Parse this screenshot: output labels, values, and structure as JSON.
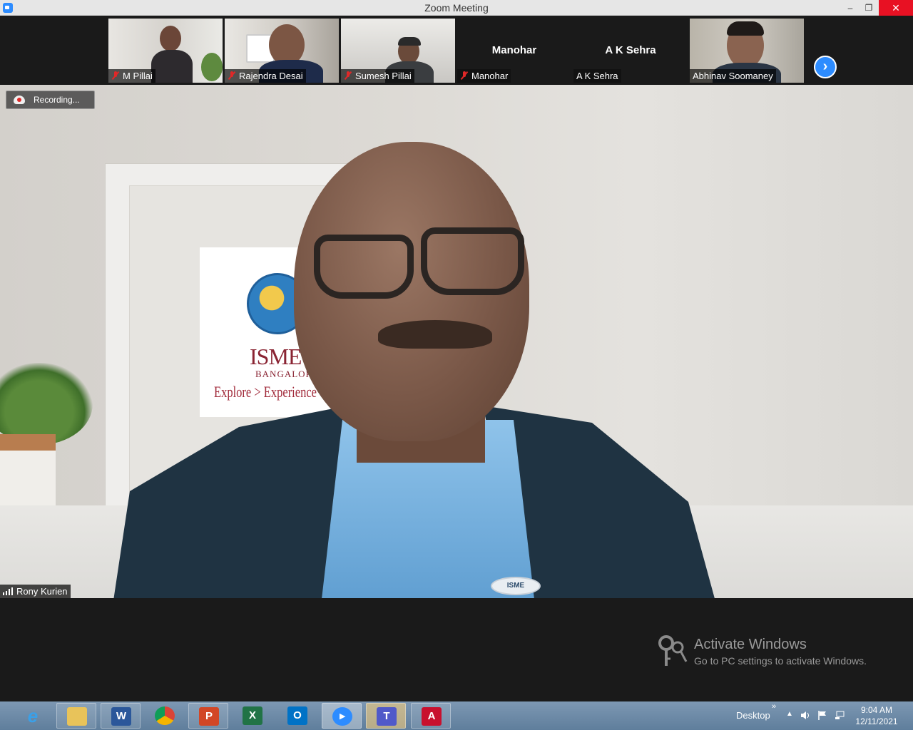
{
  "window": {
    "title": "Zoom Meeting",
    "minimize": "–",
    "restore": "❐",
    "close": "✕"
  },
  "participants": [
    {
      "name": "M Pillai",
      "muted": true,
      "video": true
    },
    {
      "name": "Rajendra Desai",
      "muted": true,
      "video": true
    },
    {
      "name": "Sumesh Pillai",
      "muted": true,
      "video": true
    },
    {
      "name": "Manohar",
      "muted": true,
      "video": false,
      "center_name": "Manohar"
    },
    {
      "name": "A K Sehra",
      "muted": false,
      "video": false,
      "center_name": "A K Sehra"
    },
    {
      "name": "Abhinav Soomaney",
      "muted": false,
      "video": true
    }
  ],
  "next_arrow_icon": "chevron-right-icon",
  "recording": {
    "label": "Recording..."
  },
  "active_speaker": {
    "name": "Rony Kurien"
  },
  "background_poster": {
    "title": "ISME",
    "subtitle": "BANGALORE",
    "tagline": "Explore > Experience > Ex"
  },
  "speaker_badge": "ISME",
  "activation": {
    "title": "Activate Windows",
    "subtitle": "Go to PC settings to activate Windows."
  },
  "taskbar": {
    "apps": [
      "internet-explorer-icon",
      "file-explorer-icon",
      "word-icon",
      "chrome-icon",
      "powerpoint-icon",
      "excel-icon",
      "outlook-icon",
      "zoom-icon",
      "teams-icon",
      "acrobat-icon"
    ],
    "desktop_label": "Desktop",
    "chevron": "»",
    "time": "9:04 AM",
    "date": "12/11/2021"
  },
  "colors": {
    "zoom_blue": "#2d8cff",
    "close_red": "#e81123",
    "mute_red": "#e02828"
  }
}
